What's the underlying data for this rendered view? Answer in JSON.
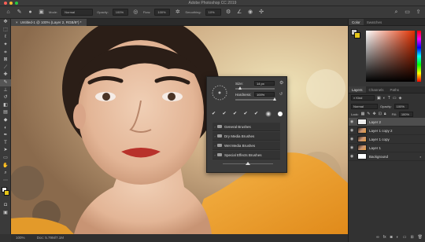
{
  "app": {
    "title": "Adobe Photoshop CC 2019",
    "traffic_lights": [
      "#fe5f57",
      "#febc2e",
      "#28c840"
    ]
  },
  "options_bar": {
    "mode_label": "Mode:",
    "mode_value": "Normal",
    "opacity_label": "Opacity:",
    "opacity_value": "100%",
    "flow_label": "Flow:",
    "flow_value": "100%",
    "smoothing_label": "Smoothing:",
    "smoothing_value": "10%"
  },
  "document": {
    "tab_label": "Untitled-1 @ 100% (Layer 2, RGB/8*) *",
    "zoom": "100%",
    "doc_info": "Doc: 5.79M/7.1M"
  },
  "brush_popup": {
    "size_label": "Size:",
    "size_value": "14 px",
    "hardness_label": "Hardness:",
    "hardness_value": "100%",
    "size_level": 0.12,
    "hardness_level": 1.0,
    "groups": [
      "General Brushes",
      "Dry Media Brushes",
      "Wet Media Brushes",
      "Special Effects Brushes"
    ]
  },
  "color_panel": {
    "tabs": [
      "Color",
      "Swatches"
    ],
    "accent": "#e03000"
  },
  "layers_panel": {
    "tabs": [
      "Layers",
      "Channels",
      "Paths"
    ],
    "kind_label": "Kind",
    "blend_mode": "Normal",
    "opacity_label": "Opacity:",
    "opacity_value": "100%",
    "lock_label": "Lock:",
    "fill_label": "Fill:",
    "fill_value": "100%",
    "layers": [
      {
        "name": "Layer 2",
        "selected": true
      },
      {
        "name": "Layer 1 copy 2",
        "selected": false
      },
      {
        "name": "Layer 1 copy",
        "selected": false
      },
      {
        "name": "Layer 1",
        "selected": false
      },
      {
        "name": "Background",
        "selected": false
      }
    ]
  }
}
